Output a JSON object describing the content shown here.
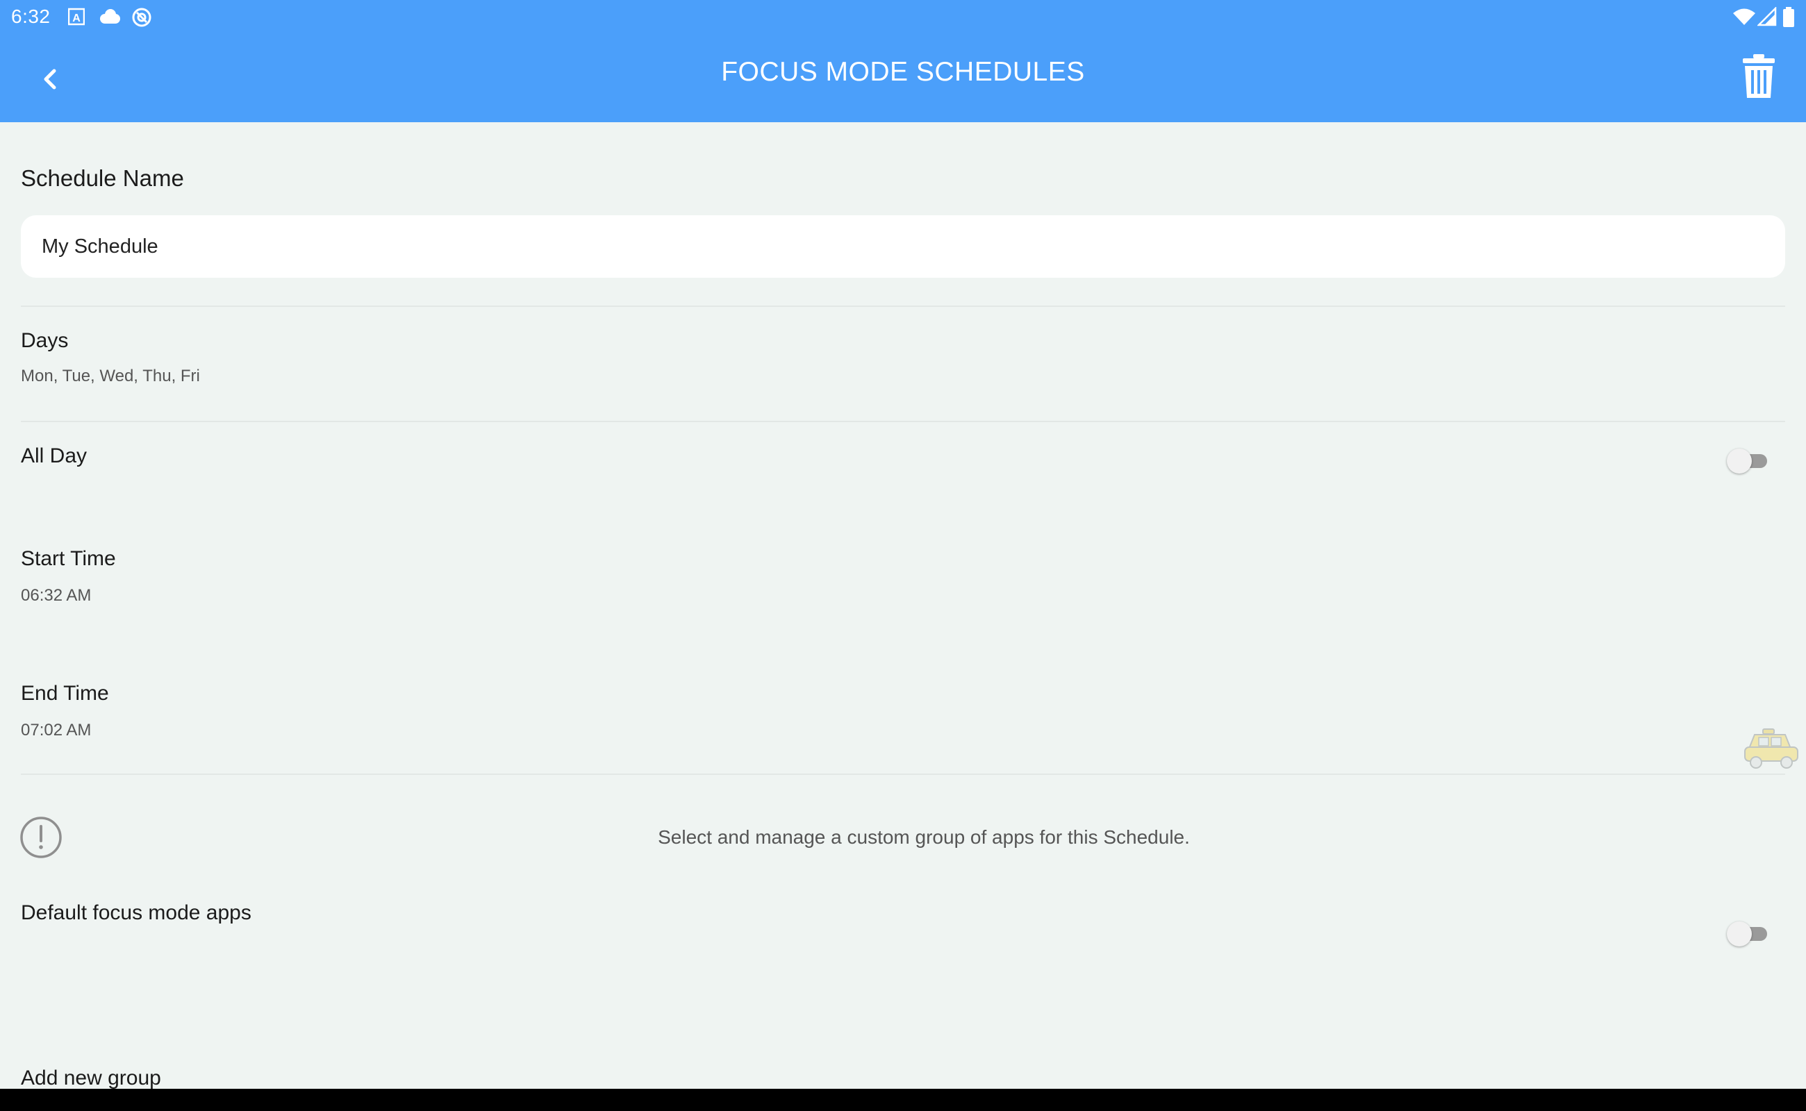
{
  "status_bar": {
    "time": "6:32",
    "left_icons": [
      "text-a-icon",
      "cloud-icon",
      "at-sync-icon"
    ],
    "right_icons": [
      "wifi-icon",
      "signal-icon",
      "battery-icon"
    ]
  },
  "app_bar": {
    "title": "FOCUS MODE SCHEDULES",
    "back_icon": "chevron-left-icon",
    "delete_icon": "trash-icon",
    "color": "#4b9ffa"
  },
  "schedule_name": {
    "label": "Schedule Name",
    "value": "My Schedule"
  },
  "days": {
    "label": "Days",
    "value": "Mon, Tue, Wed, Thu, Fri"
  },
  "all_day": {
    "label": "All Day",
    "enabled": false
  },
  "start_time": {
    "label": "Start Time",
    "value": "06:32 AM"
  },
  "end_time": {
    "label": "End Time",
    "value": "07:02 AM"
  },
  "info": {
    "icon": "exclamation-circle-icon",
    "text": "Select and manage a custom group of apps for this Schedule."
  },
  "default_apps": {
    "label": "Default focus mode apps",
    "enabled": false
  },
  "add_group": {
    "label": "Add new group"
  },
  "colors": {
    "background": "#eff4f2",
    "accent": "#4b9ffa"
  }
}
